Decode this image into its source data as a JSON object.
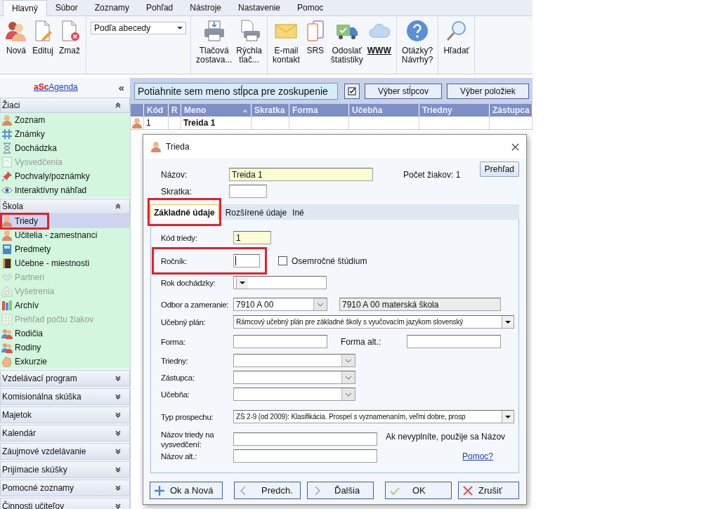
{
  "menu_tabs": [
    {
      "label": "Hlavný",
      "selected": true
    },
    {
      "label": "Súbor",
      "selected": false
    },
    {
      "label": "Zoznamy",
      "selected": false
    },
    {
      "label": "Pohľad",
      "selected": false
    },
    {
      "label": "Nástroje",
      "selected": false
    },
    {
      "label": "Nastavenie",
      "selected": false
    },
    {
      "label": "Pomoc",
      "selected": false
    }
  ],
  "ribbon": {
    "groups": [
      {
        "kind": "buttons",
        "buttons": [
          {
            "lines": [
              "Nová"
            ],
            "bold": false
          },
          {
            "lines": [
              "Edituj"
            ],
            "bold": false
          },
          {
            "lines": [
              "Zmaž"
            ],
            "bold": false
          }
        ]
      },
      {
        "kind": "dropdown",
        "value": "Podľa abecedy"
      },
      {
        "kind": "buttons",
        "buttons": [
          {
            "lines": [
              "Tlačová",
              "zostava..."
            ],
            "bold": false
          },
          {
            "lines": [
              "Rýchla",
              "tlač..."
            ],
            "bold": false
          }
        ]
      },
      {
        "kind": "buttons",
        "buttons": [
          {
            "lines": [
              "E-mail",
              "kontakt"
            ],
            "bold": false
          },
          {
            "lines": [
              "SRS"
            ],
            "bold": false
          },
          {
            "lines": [
              "Odoslať",
              "štatistiky"
            ],
            "bold": false
          },
          {
            "lines": [
              "WWW"
            ],
            "bold": true
          }
        ]
      },
      {
        "kind": "buttons",
        "buttons": [
          {
            "lines": [
              "Otázky?",
              "Návrhy?"
            ],
            "bold": false
          }
        ]
      },
      {
        "kind": "buttons",
        "buttons": [
          {
            "lines": [
              "Hľadať"
            ],
            "bold": false
          }
        ]
      }
    ]
  },
  "sidebar": {
    "logo": {
      "brand": "aSc",
      "name": "Agenda"
    },
    "collapse": "«",
    "sections": [
      {
        "title": "Žiaci",
        "expanded": true,
        "items": [
          {
            "label": "Zoznam",
            "disabled": false,
            "selected": false,
            "highlighted": false
          },
          {
            "label": "Známky",
            "disabled": false,
            "selected": false,
            "highlighted": false
          },
          {
            "label": "Dochádzka",
            "disabled": false,
            "selected": false,
            "highlighted": false
          },
          {
            "label": "Vysvedčenia",
            "disabled": true,
            "selected": false,
            "highlighted": false
          },
          {
            "label": "Pochvaly/poznámky",
            "disabled": false,
            "selected": false,
            "highlighted": false
          },
          {
            "label": "Interaktívny náhľad",
            "disabled": false,
            "selected": false,
            "highlighted": false
          }
        ]
      },
      {
        "title": "Škola",
        "expanded": true,
        "items": [
          {
            "label": "Triedy",
            "disabled": false,
            "selected": true,
            "highlighted": true
          },
          {
            "label": "Učitelia - zamestnanci",
            "disabled": false,
            "selected": false,
            "highlighted": false
          },
          {
            "label": "Predmety",
            "disabled": false,
            "selected": false,
            "highlighted": false
          },
          {
            "label": "Učebne - miestnosti",
            "disabled": false,
            "selected": false,
            "highlighted": false
          },
          {
            "label": "Partneri",
            "disabled": true,
            "selected": false,
            "highlighted": false
          },
          {
            "label": "Vyšetrenia",
            "disabled": true,
            "selected": false,
            "highlighted": false
          },
          {
            "label": "Archív",
            "disabled": false,
            "selected": false,
            "highlighted": false
          },
          {
            "label": "Prehľad počtu žiakov",
            "disabled": true,
            "selected": false,
            "highlighted": false
          },
          {
            "label": "Rodičia",
            "disabled": false,
            "selected": false,
            "highlighted": false
          },
          {
            "label": "Rodiny",
            "disabled": false,
            "selected": false,
            "highlighted": false
          },
          {
            "label": "Exkurzie",
            "disabled": false,
            "selected": false,
            "highlighted": false
          }
        ]
      },
      {
        "title": "Vzdelávací program",
        "expanded": false
      },
      {
        "title": "Komisionálna skúška",
        "expanded": false
      },
      {
        "title": "Majetok",
        "expanded": false
      },
      {
        "title": "Kalendár",
        "expanded": false
      },
      {
        "title": "Záujmové vzdelávanie",
        "expanded": false
      },
      {
        "title": "Prijímacie skúšky",
        "expanded": false
      },
      {
        "title": "Pomocné zoznamy",
        "expanded": false
      },
      {
        "title": "Činnosti učiteľov",
        "expanded": false
      }
    ]
  },
  "group_bar": {
    "hint": "Potiahnite sem meno stĺpca pre zoskupenie",
    "buttons": [
      "Výber stĺpcov",
      "Výber položiek"
    ]
  },
  "table": {
    "columns": [
      {
        "label": "Kód",
        "sorted": false
      },
      {
        "label": "R",
        "sorted": false
      },
      {
        "label": "Meno",
        "sorted": true
      },
      {
        "label": "Skratka",
        "sorted": false
      },
      {
        "label": "Forma",
        "sorted": false
      },
      {
        "label": "Učebňa",
        "sorted": false
      },
      {
        "label": "Triedny",
        "sorted": false
      },
      {
        "label": "Zástupca",
        "sorted": false
      }
    ],
    "rows": [
      {
        "kod": "1",
        "meno": "Treida 1"
      }
    ]
  },
  "dialog": {
    "title": "Trieda",
    "nazov": {
      "label": "Názov:",
      "value": "Treida 1"
    },
    "skratka": {
      "label": "Skratka:"
    },
    "count": "Počet žiakov: 1",
    "overview_button": "Prehľad",
    "tabs": [
      {
        "label": "Základné údaje",
        "selected": true,
        "highlighted": true
      },
      {
        "label": "Rozšírené údaje",
        "selected": false,
        "highlighted": false
      },
      {
        "label": "Iné",
        "selected": false,
        "highlighted": false
      }
    ],
    "form": {
      "kod_triedy": {
        "label": "Kód triedy:",
        "value": "1"
      },
      "rocnik": {
        "label": "Ročník:",
        "highlighted": true,
        "checkbox": {
          "label": "Osemročné štúdium",
          "checked": false
        }
      },
      "rok_dochadzky": {
        "label": "Rok dochádzky:"
      },
      "odbor": {
        "label": "Odbor a zameranie:",
        "value": "7910 A 00",
        "description": "7910 A 00 materská škola"
      },
      "ucebny_plan": {
        "label": "Učebný plán:",
        "value": "Rámcový učebný plán pre základné školy s vyučovacím jazykom slovenský"
      },
      "forma": {
        "label": "Forma:"
      },
      "forma_alt": {
        "label": "Forma alt.:"
      },
      "triedny": {
        "label": "Triedny:"
      },
      "zastupca": {
        "label": "Zástupca:"
      },
      "ucebna": {
        "label": "Učebňa:"
      },
      "typ_prospechu": {
        "label": "Typ prospechu:",
        "value": "ZŠ 2-9 (od 2009): Klasifikácia. Prospel s vyznamenaním, veľmi dobre, prosp"
      },
      "nazov_vysvedcenie": {
        "label": "Názov triedy na vysvedčení:",
        "note": "Ak nevyplníte, použije sa Názov"
      },
      "nazov_alt": {
        "label": "Názov alt.:"
      },
      "help_link": "Pomoc?"
    },
    "buttons": [
      {
        "label": "Ok a Nová",
        "kind": "plus"
      },
      {
        "label": "Predch.",
        "kind": "prev"
      },
      {
        "label": "Ďalšia",
        "kind": "next"
      },
      {
        "label": "OK",
        "kind": "ok"
      },
      {
        "label": "Zrušiť",
        "kind": "cancel"
      }
    ]
  }
}
